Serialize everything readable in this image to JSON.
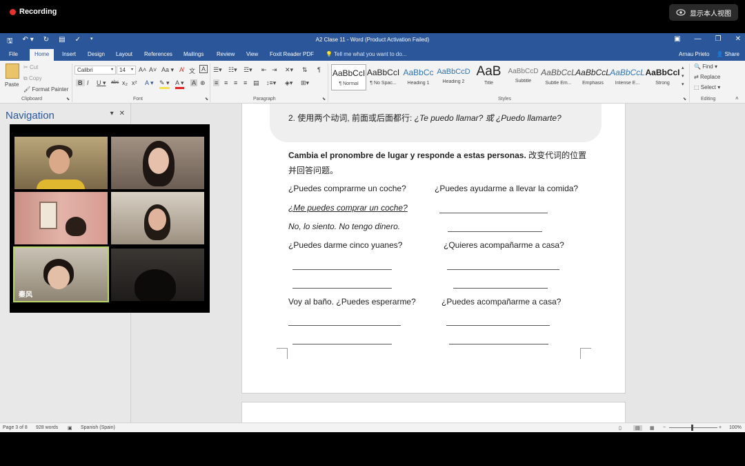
{
  "recording": {
    "label": "Recording"
  },
  "view_button": {
    "label": "显示本人视图"
  },
  "word": {
    "title": "A2 Clase 11 - Word (Product Activation Failed)",
    "tabs": [
      "File",
      "Home",
      "Insert",
      "Design",
      "Layout",
      "References",
      "Mailings",
      "Review",
      "View",
      "Foxit Reader PDF"
    ],
    "tell_me": "Tell me what you want to do...",
    "user": "Arnau Prieto",
    "share": "Share"
  },
  "ribbon": {
    "clipboard": {
      "paste": "Paste",
      "cut": "Cut",
      "copy": "Copy",
      "format_painter": "Format Painter",
      "label": "Clipboard"
    },
    "font": {
      "name": "Calibri",
      "size": "14",
      "label": "Font"
    },
    "paragraph": {
      "label": "Paragraph"
    },
    "styles": {
      "label": "Styles",
      "items": [
        {
          "sample": "AaBbCcI",
          "name": "¶ Normal"
        },
        {
          "sample": "AaBbCcI",
          "name": "¶ No Spac..."
        },
        {
          "sample": "AaBbCc",
          "name": "Heading 1"
        },
        {
          "sample": "AaBbCcD",
          "name": "Heading 2"
        },
        {
          "sample": "AaB",
          "name": "Title"
        },
        {
          "sample": "AaBbCcD",
          "name": "Subtitle"
        },
        {
          "sample": "AaBbCcL",
          "name": "Subtle Em..."
        },
        {
          "sample": "AaBbCcL",
          "name": "Emphasis"
        },
        {
          "sample": "AaBbCcL",
          "name": "Intense E..."
        },
        {
          "sample": "AaBbCcI",
          "name": "Strong"
        }
      ]
    },
    "editing": {
      "find": "Find",
      "replace": "Replace",
      "select": "Select",
      "label": "Editing"
    }
  },
  "navigation": {
    "title": "Navigation"
  },
  "document": {
    "line1_prefix": "2. 使用两个动词, 前面或后面都行: ",
    "line1_it": "¿Te puedo llamar? 或 ¿Puedo llamarte?",
    "instr_bold": "Cambia el pronombre de lugar y responde a estas personas.",
    "instr_cn1": " 改变代词的位置",
    "instr_cn2": "并回答问题。",
    "q1": "¿Puedes comprarme un coche?",
    "q2": "¿Puedes ayudarme a llevar la comida?",
    "a1": "¿Me puedes comprar un coche?",
    "a2": "No, lo siento. No tengo dinero.",
    "q3": "¿Puedes darme cinco yuanes?",
    "q4": "¿Quieres acompañarme a casa?",
    "q5": "Voy al baño. ¿Puedes esperarme?",
    "q6": "¿Puedes acompañarme a casa?"
  },
  "status": {
    "page": "Page 3 of 8",
    "words": "928 words",
    "language": "Spanish (Spain)",
    "zoom": "100%"
  },
  "video": {
    "participant_name": "秦风"
  }
}
